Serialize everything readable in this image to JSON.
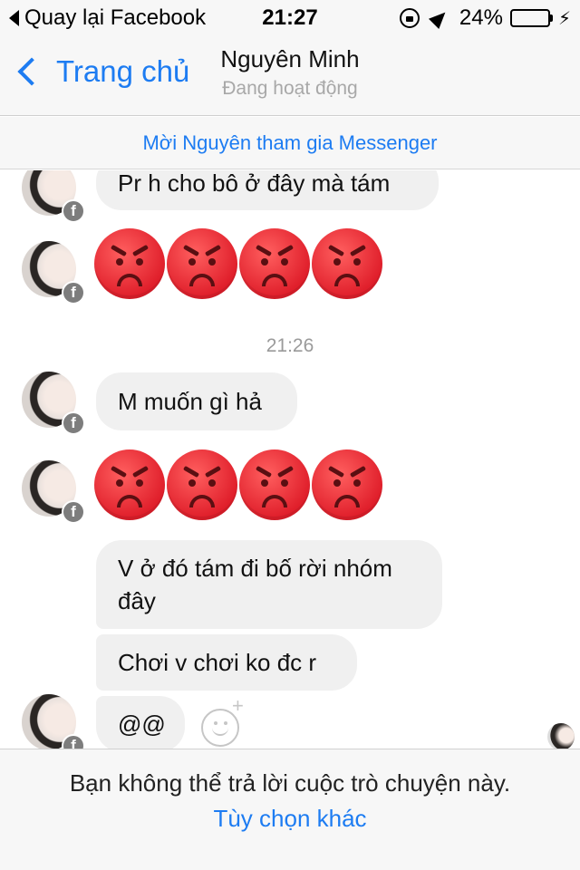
{
  "status_bar": {
    "back_label": "Quay lại Facebook",
    "time": "21:27",
    "battery_percent": "24%",
    "battery_level": 0.24,
    "icons": [
      "orientation-lock-icon",
      "location-arrow-icon",
      "battery-icon",
      "charging-bolt-icon"
    ]
  },
  "nav": {
    "back_label": "Trang chủ",
    "title": "Nguyên Minh",
    "subtitle": "Đang hoạt động"
  },
  "invite": {
    "label": "Mời Nguyên tham gia Messenger"
  },
  "chat": {
    "messages": [
      {
        "text": "Pr h cho bô ở đây mà tám"
      },
      {
        "type": "emoji",
        "icon": "angry-face-icon",
        "count": 4
      },
      {
        "timestamp": "21:26"
      },
      {
        "text": "M muốn gì hả"
      },
      {
        "type": "emoji",
        "icon": "angry-face-icon",
        "count": 4
      },
      {
        "text": "V ở đó tám đi bố rời nhóm đây"
      },
      {
        "text": "Chơi v chơi ko đc r"
      },
      {
        "text": "@@"
      }
    ],
    "timestamp": "21:26",
    "msg1": "Pr h cho bô ở đây mà tám",
    "msg2": "M muốn gì hả",
    "msg3": "V ở đó tám đi bố rời nhóm đây",
    "msg4": "Chơi v chơi ko đc r",
    "msg5": "@@",
    "badge_icon": "facebook-icon",
    "badge_glyph": "f",
    "plus_glyph": "+"
  },
  "footer": {
    "message": "Bạn không thể trả lời cuộc trò chuyện này.",
    "link": "Tùy chọn khác"
  },
  "colors": {
    "accent": "#1d7cf2",
    "bubble": "#f0f0f0",
    "emoji_red": "#e01f2b",
    "battery": "#f5c518"
  }
}
